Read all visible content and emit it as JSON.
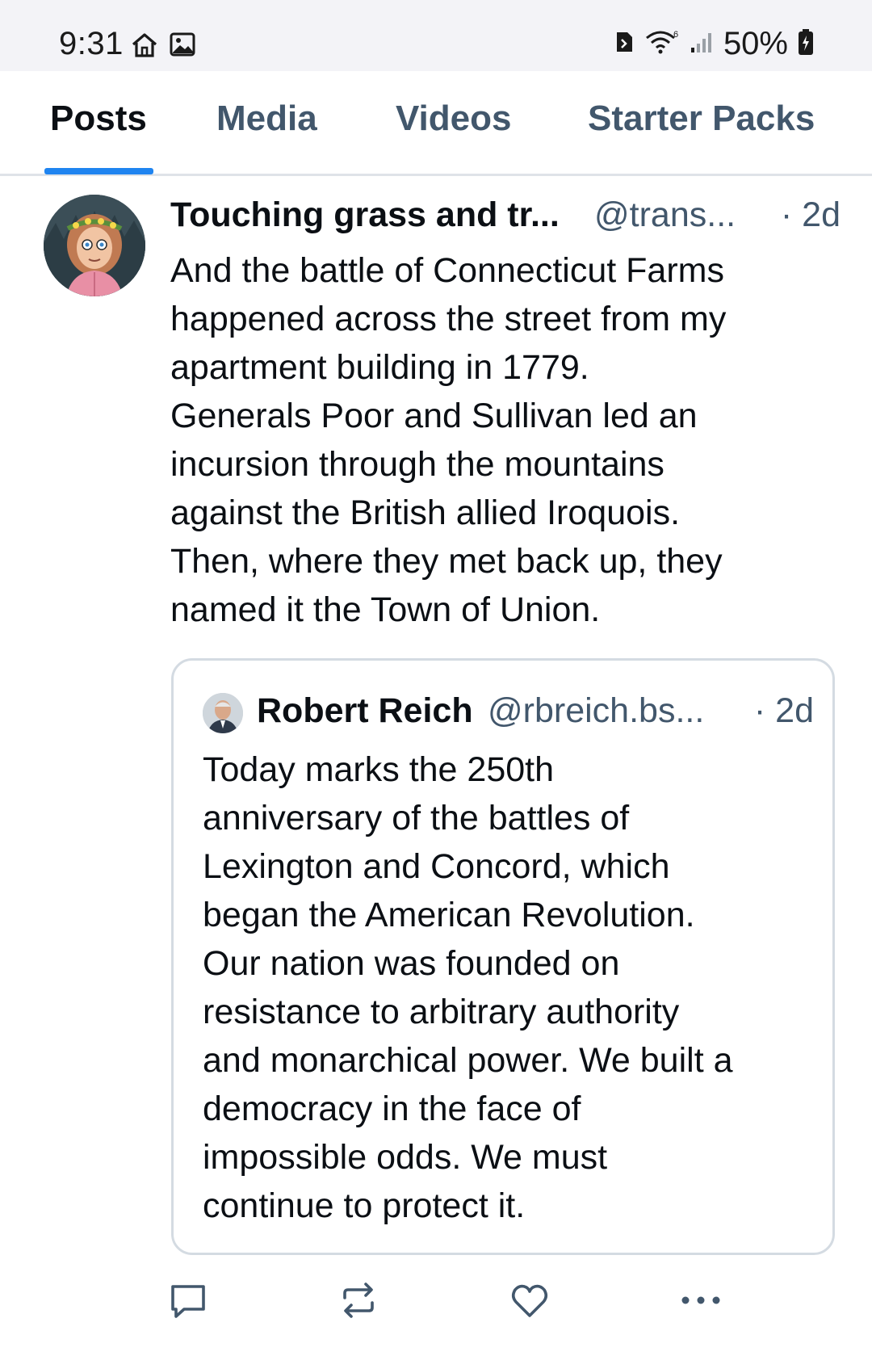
{
  "status_bar": {
    "time": "9:31",
    "battery": "50%",
    "left_icons": [
      "home-icon",
      "image-icon"
    ],
    "right_icons": [
      "sim-icon",
      "wifi-icon",
      "signal-icon",
      "battery-icon"
    ]
  },
  "tabs": [
    {
      "label": "Posts",
      "active": true
    },
    {
      "label": "Media",
      "active": false
    },
    {
      "label": "Videos",
      "active": false
    },
    {
      "label": "Starter Packs",
      "active": false
    }
  ],
  "post": {
    "author_name": "Touching grass and tr...",
    "author_handle": "@trans...",
    "time": "· 2d",
    "body_lines": [
      "And the battle of Connecticut Farms",
      "happened across the street from my",
      "apartment building in 1779.",
      "Generals Poor and Sullivan led an",
      "incursion through the mountains",
      "against the British allied Iroquois.",
      "Then, where they met back up, they",
      "named it the Town of Union."
    ],
    "quote": {
      "author_name": "Robert Reich",
      "author_handle": "@rbreich.bs...",
      "time": "· 2d",
      "body_lines": [
        "Today marks the 250th",
        "anniversary of the battles of",
        "Lexington and Concord, which",
        "began the American Revolution.",
        "Our nation was founded on",
        "resistance to arbitrary authority",
        "and monarchical power. We built a",
        "democracy in the face of",
        "impossible odds. We must",
        "continue to protect it."
      ]
    },
    "actions": [
      "reply-icon",
      "repost-icon",
      "like-icon",
      "more-icon"
    ]
  },
  "colors": {
    "accent": "#1f84f0",
    "muted_text": "#42576c",
    "text": "#0b0f14",
    "border": "#d4dbe2",
    "status_bg": "#f3f3f7"
  }
}
